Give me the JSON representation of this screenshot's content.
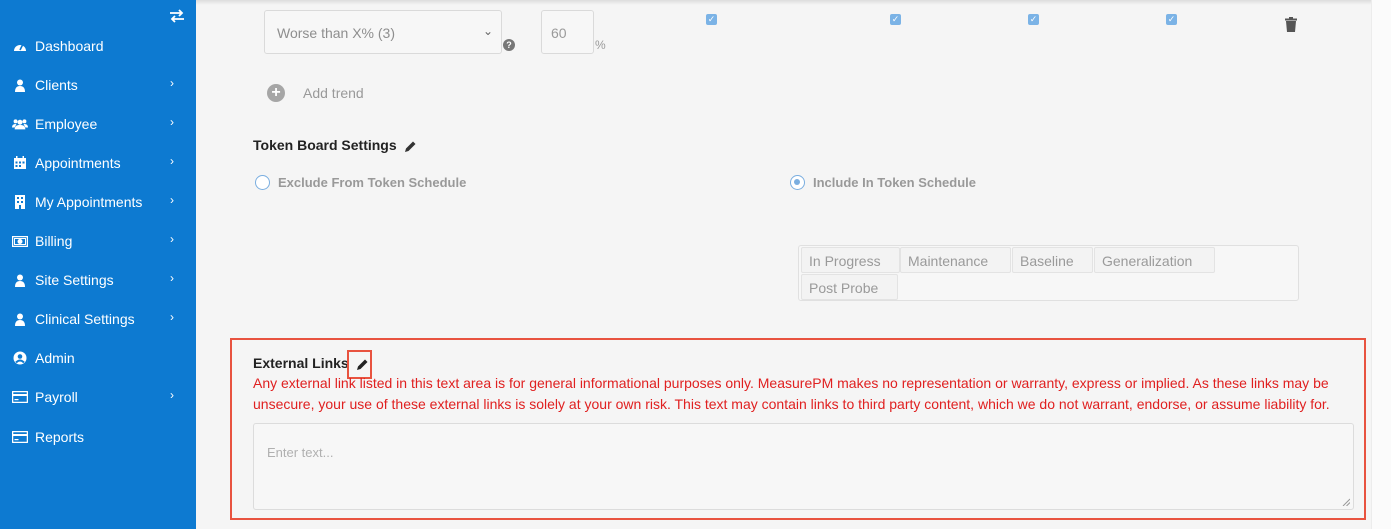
{
  "sidebar": {
    "toggle_icon": "swap-arrows-icon",
    "items": [
      {
        "label": "Dashboard",
        "icon": "dashboard-icon",
        "chevron": false
      },
      {
        "label": "Clients",
        "icon": "user-icon",
        "chevron": true
      },
      {
        "label": "Employee",
        "icon": "users-icon",
        "chevron": true
      },
      {
        "label": "Appointments",
        "icon": "calendar-icon",
        "chevron": true
      },
      {
        "label": "My Appointments",
        "icon": "building-icon",
        "chevron": true
      },
      {
        "label": "Billing",
        "icon": "money-icon",
        "chevron": true
      },
      {
        "label": "Site Settings",
        "icon": "user-icon",
        "chevron": true
      },
      {
        "label": "Clinical Settings",
        "icon": "user-icon",
        "chevron": true
      },
      {
        "label": "Admin",
        "icon": "user-circle-icon",
        "chevron": false
      },
      {
        "label": "Payroll",
        "icon": "credit-card-icon",
        "chevron": true
      },
      {
        "label": "Reports",
        "icon": "credit-card-icon",
        "chevron": false
      }
    ],
    "chevron_glyph": "›",
    "color": "#0d7ad1"
  },
  "trend_row": {
    "select_value": "Worse than X% (3)",
    "caret": "⌄",
    "help": "?",
    "percent_value": "60",
    "percent_sign": "%",
    "checkboxes": [
      true,
      true,
      true,
      true
    ],
    "check_glyph": "✓"
  },
  "add_trend": {
    "plus": "+",
    "label": "Add trend"
  },
  "token_board": {
    "title": "Token Board Settings",
    "options": [
      {
        "label": "Exclude From Token Schedule",
        "selected": false
      },
      {
        "label": "Include In Token Schedule",
        "selected": true
      }
    ],
    "tags": [
      "In Progress",
      "Maintenance",
      "Baseline",
      "Generalization",
      "Post Probe"
    ]
  },
  "external_links": {
    "title": "External Links",
    "disclaimer": "Any external link listed in this text area is for general informational purposes only. MeasurePM makes no representation or warranty, express or implied. As these links may be unsecure, your use of these external links is solely at your own risk. This text may contain links to third party content, which we do not warrant, endorse, or assume liability for.",
    "placeholder": "Enter text...",
    "highlight_color": "#e8533f",
    "disclaimer_color": "#e02020"
  }
}
